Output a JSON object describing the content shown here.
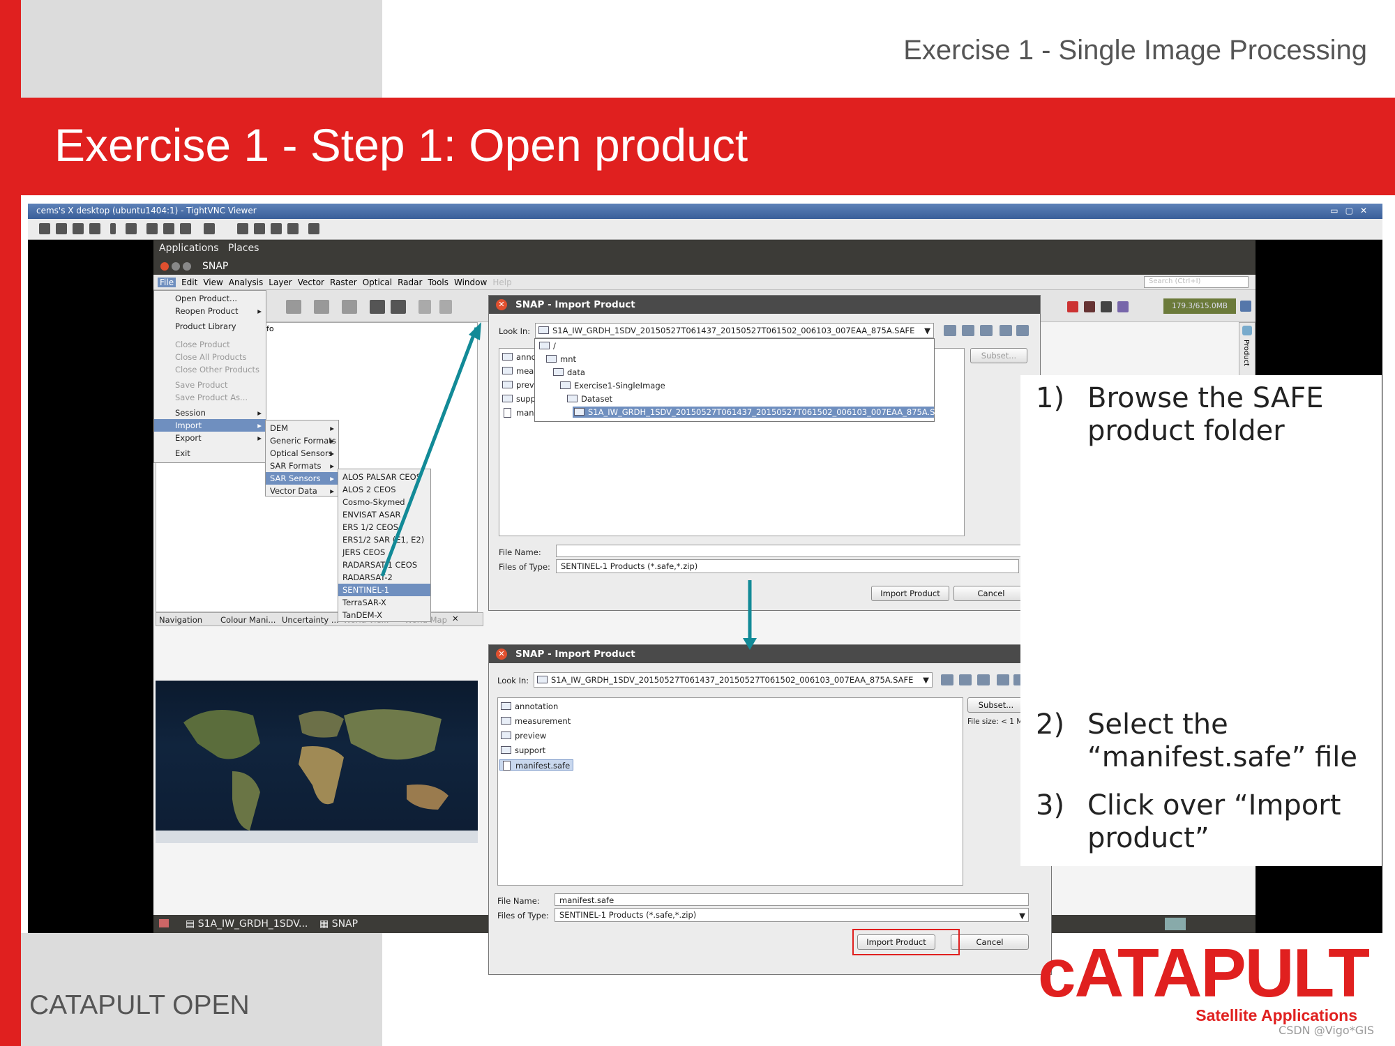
{
  "header": {
    "title": "Exercise 1 - Single Image Processing"
  },
  "slide": {
    "title": "Exercise 1 - Step 1: Open product"
  },
  "vnc": {
    "title": "cems's X desktop (ubuntu1404:1) - TightVNC Viewer"
  },
  "gnome": {
    "applications": "Applications",
    "places": "Places"
  },
  "snap": {
    "title": "SNAP",
    "menu": [
      "File",
      "Edit",
      "View",
      "Analysis",
      "Layer",
      "Vector",
      "Raster",
      "Optical",
      "Radar",
      "Tools",
      "Window",
      "Help"
    ],
    "search_placeholder": "Search (Ctrl+I)",
    "memory": "179.3/615.0MB",
    "product_tab": "Product",
    "info_tab": "fo",
    "bottom_tabs": [
      "Navigation",
      "Colour Mani...",
      "Uncertainty ...",
      "World Vie...",
      "World Map"
    ],
    "taskbar": {
      "item1": "S1A_IW_GRDH_1SDV...",
      "item2": "SNAP"
    }
  },
  "file_menu": {
    "items": [
      "Open Product...",
      "Reopen Product",
      "Product Library",
      "Close Product",
      "Close All Products",
      "Close Other Products",
      "Save Product",
      "Save Product As...",
      "Session",
      "Import",
      "Export",
      "Exit"
    ]
  },
  "import_menu": {
    "items": [
      "DEM",
      "Generic Formats",
      "Optical Sensors",
      "SAR Formats",
      "SAR Sensors",
      "Vector Data"
    ]
  },
  "sar_sensors_menu": {
    "items": [
      "ALOS PALSAR CEOS",
      "ALOS 2 CEOS",
      "Cosmo-Skymed",
      "ENVISAT ASAR",
      "ERS 1/2 CEOS",
      "ERS1/2 SAR (E1, E2)",
      "JERS CEOS",
      "RADARSAT-1 CEOS",
      "RADARSAT-2",
      "SENTINEL-1",
      "TerraSAR-X",
      "TanDEM-X"
    ]
  },
  "dialog1": {
    "title": "SNAP - Import Product",
    "look_in_label": "Look In:",
    "look_in_value": "S1A_IW_GRDH_1SDV_20150527T061437_20150527T061502_006103_007EAA_875A.SAFE",
    "tree": [
      "/",
      "mnt",
      "data",
      "Exercise1-SingleImage",
      "Dataset",
      "S1A_IW_GRDH_1SDV_20150527T061437_20150527T061502_006103_007EAA_875A.SAFE"
    ],
    "files_partial": [
      "annot",
      "meas",
      "previ",
      "suppo",
      "manif"
    ],
    "subset_button": "Subset...",
    "file_name_label": "File Name:",
    "file_name_value": "",
    "files_of_type_label": "Files of Type:",
    "files_of_type_value": "SENTINEL-1 Products (*.safe,*.zip)",
    "import_button": "Import Product",
    "cancel_button": "Cancel"
  },
  "dialog2": {
    "title": "SNAP - Import Product",
    "look_in_label": "Look In:",
    "look_in_value": "S1A_IW_GRDH_1SDV_20150527T061437_20150527T061502_006103_007EAA_875A.SAFE",
    "files": [
      "annotation",
      "measurement",
      "preview",
      "support",
      "manifest.safe"
    ],
    "subset_button": "Subset...",
    "file_size": "File size: < 1 M",
    "file_name_label": "File Name:",
    "file_name_value": "manifest.safe",
    "files_of_type_label": "Files of Type:",
    "files_of_type_value": "SENTINEL-1 Products (*.safe,*.zip)",
    "import_button": "Import Product",
    "cancel_button": "Cancel"
  },
  "steps": [
    {
      "num": "1)",
      "text": "Browse the SAFE product folder"
    },
    {
      "num": "2)",
      "text": "Select the “manifest.safe” file"
    },
    {
      "num": "3)",
      "text": "Click over “Import product”"
    }
  ],
  "footer": {
    "left": "CATAPULT OPEN",
    "credit": "CSDN @Vigo*GIS"
  },
  "logo": {
    "main": "cATAPULT",
    "sub": "Satellite Applications"
  },
  "colors": {
    "brand_red": "#e0201f",
    "teal_arrow": "#128a97",
    "highlight": "#6f8fbf"
  }
}
